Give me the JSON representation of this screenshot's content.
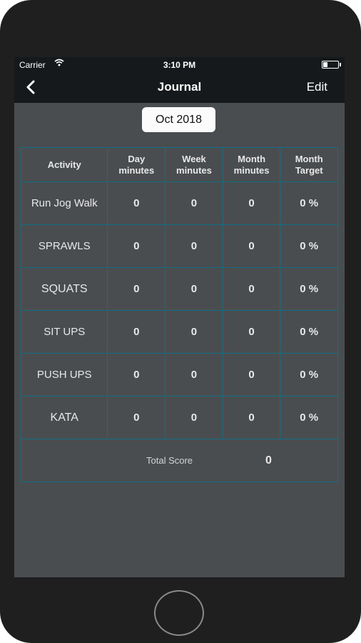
{
  "status": {
    "carrier": "Carrier",
    "time": "3:10 PM"
  },
  "nav": {
    "title": "Journal",
    "edit": "Edit"
  },
  "month_label": "Oct 2018",
  "table": {
    "headers": [
      "Activity",
      "Day\nminutes",
      "Week\nminutes",
      "Month\nminutes",
      "Month\nTarget"
    ],
    "rows": [
      {
        "activity": "Run Jog Walk",
        "day": "0",
        "week": "0",
        "month": "0",
        "target": "0 %"
      },
      {
        "activity": "SPRAWLS",
        "day": "0",
        "week": "0",
        "month": "0",
        "target": "0 %"
      },
      {
        "activity": "SQUATS",
        "day": "0",
        "week": "0",
        "month": "0",
        "target": "0 %"
      },
      {
        "activity": "SIT UPS",
        "day": "0",
        "week": "0",
        "month": "0",
        "target": "0 %"
      },
      {
        "activity": "PUSH UPS",
        "day": "0",
        "week": "0",
        "month": "0",
        "target": "0 %"
      },
      {
        "activity": "KATA",
        "day": "0",
        "week": "0",
        "month": "0",
        "target": "0 %"
      }
    ],
    "total_label": "Total Score",
    "total_value": "0"
  }
}
